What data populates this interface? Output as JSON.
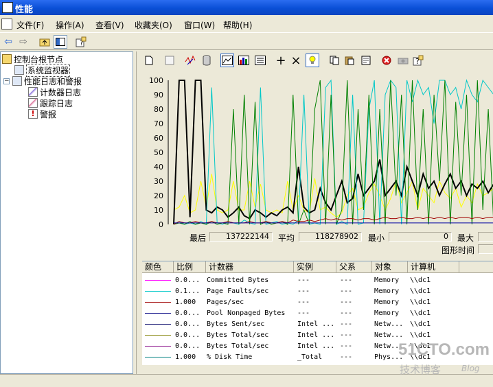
{
  "window": {
    "title": "性能"
  },
  "menu": [
    "文件(F)",
    "操作(A)",
    "查看(V)",
    "收藏夹(O)",
    "窗口(W)",
    "帮助(H)"
  ],
  "tree": {
    "items": [
      {
        "label": "控制台根节点",
        "level": 0,
        "icon": "folder-icon"
      },
      {
        "label": "系统监视器",
        "level": 1,
        "icon": "monitor-icon",
        "selected": true
      },
      {
        "label": "性能日志和警报",
        "level": 1,
        "icon": "logs-icon",
        "expanded": true
      },
      {
        "label": "计数器日志",
        "level": 2,
        "icon": "counter-log-icon"
      },
      {
        "label": "跟踪日志",
        "level": 2,
        "icon": "trace-log-icon"
      },
      {
        "label": "警报",
        "level": 2,
        "icon": "alert-icon"
      }
    ]
  },
  "stats": {
    "last_label": "最后",
    "last_value": "137222144",
    "avg_label": "平均",
    "avg_value": "118278902",
    "min_label": "最小",
    "min_value": "0",
    "max_label": "最大",
    "duration_label": "图形时间"
  },
  "legend": {
    "headers": [
      "颜色",
      "比例",
      "计数器",
      "实例",
      "父系",
      "对象",
      "计算机"
    ],
    "rows": [
      {
        "color": "#ff00ff",
        "scale": "0.0...",
        "counter": "Committed Bytes",
        "instance": "---",
        "parent": "---",
        "object": "Memory",
        "computer": "\\\\dc1"
      },
      {
        "color": "#00c8c8",
        "scale": "0.1...",
        "counter": "Page Faults/sec",
        "instance": "---",
        "parent": "---",
        "object": "Memory",
        "computer": "\\\\dc1"
      },
      {
        "color": "#a00000",
        "scale": "1.000",
        "counter": "Pages/sec",
        "instance": "---",
        "parent": "---",
        "object": "Memory",
        "computer": "\\\\dc1"
      },
      {
        "color": "#000080",
        "scale": "0.0...",
        "counter": "Pool Nonpaged Bytes",
        "instance": "---",
        "parent": "---",
        "object": "Memory",
        "computer": "\\\\dc1"
      },
      {
        "color": "#000064",
        "scale": "0.0...",
        "counter": "Bytes Sent/sec",
        "instance": "Intel ...",
        "parent": "---",
        "object": "Netw...",
        "computer": "\\\\dc1"
      },
      {
        "color": "#808000",
        "scale": "0.0...",
        "counter": "Bytes Total/sec",
        "instance": "Intel ...",
        "parent": "---",
        "object": "Netw...",
        "computer": "\\\\dc1"
      },
      {
        "color": "#800080",
        "scale": "0.0...",
        "counter": "Bytes Total/sec",
        "instance": "Intel ...",
        "parent": "---",
        "object": "Netw...",
        "computer": "\\\\dc1"
      },
      {
        "color": "#008080",
        "scale": "1.000",
        "counter": "% Disk Time",
        "instance": "_Total",
        "parent": "---",
        "object": "Phys...",
        "computer": "\\\\dc1"
      }
    ]
  },
  "watermark": {
    "line1": "51CTO.com",
    "line2": "技术博客",
    "line3": "Blog"
  },
  "chart_data": {
    "type": "line",
    "ylim": [
      0,
      100
    ],
    "yticks": [
      "100",
      "90",
      "80",
      "70",
      "60",
      "50",
      "40",
      "30",
      "20",
      "10",
      "0"
    ],
    "grid": false,
    "series": [
      {
        "color": "#ffff00",
        "values": [
          10,
          12,
          20,
          8,
          10,
          30,
          12,
          35,
          10,
          8,
          10,
          30,
          10,
          10,
          30,
          12,
          28,
          10,
          8,
          10,
          8,
          30,
          10,
          20,
          10,
          8,
          32,
          10,
          12,
          8,
          5,
          8,
          20,
          25,
          10,
          12,
          22,
          28,
          20,
          10,
          18,
          30,
          15,
          22,
          30,
          10,
          25,
          20,
          15,
          30,
          22,
          18,
          25,
          12,
          20,
          15,
          28,
          20,
          22,
          25
        ]
      },
      {
        "color": "#000000",
        "values": [
          0,
          100,
          100,
          5,
          100,
          100,
          10,
          8,
          12,
          10,
          5,
          8,
          12,
          6,
          4,
          10,
          8,
          5,
          8,
          6,
          10,
          12,
          8,
          40,
          12,
          8,
          10,
          25,
          15,
          10,
          20,
          30,
          15,
          18,
          35,
          20,
          25,
          30,
          45,
          20,
          25,
          30,
          20,
          40,
          30,
          20,
          35,
          25,
          30,
          20,
          28,
          35,
          25,
          30,
          20,
          28,
          25,
          30,
          22,
          28
        ]
      },
      {
        "color": "#00c8c8",
        "values": [
          0,
          2,
          0,
          1,
          0,
          2,
          0,
          95,
          1,
          0,
          2,
          1,
          0,
          3,
          1,
          0,
          95,
          0,
          1,
          2,
          0,
          1,
          0,
          3,
          90,
          0,
          1,
          0,
          95,
          100,
          0,
          2,
          0,
          90,
          0,
          1,
          80,
          100,
          0,
          90,
          100,
          95,
          0,
          100,
          85,
          100,
          90,
          95,
          70,
          100,
          100,
          90,
          95,
          80,
          100,
          90,
          85,
          100,
          95,
          90
        ]
      },
      {
        "color": "#008000",
        "values": [
          0,
          1,
          0,
          2,
          0,
          1,
          0,
          2,
          0,
          1,
          0,
          80,
          0,
          90,
          0,
          85,
          0,
          2,
          0,
          1,
          2,
          0,
          90,
          0,
          10,
          0,
          80,
          100,
          0,
          90,
          0,
          10,
          100,
          0,
          80,
          10,
          90,
          0,
          80,
          0,
          100,
          20,
          90,
          0,
          100,
          10,
          80,
          0,
          90,
          30,
          100,
          0,
          85,
          20,
          90,
          0,
          100,
          10,
          80,
          0
        ]
      },
      {
        "color": "#a00000",
        "values": [
          0,
          2,
          1,
          1,
          2,
          1,
          1,
          2,
          1,
          1,
          2,
          1,
          1,
          1,
          2,
          1,
          1,
          2,
          1,
          1,
          2,
          1,
          3,
          2,
          2,
          3,
          2,
          3,
          4,
          3,
          4,
          3,
          4,
          4,
          3,
          4,
          4,
          3,
          4,
          5,
          4,
          4,
          5,
          4,
          4,
          5,
          4,
          5,
          4,
          5,
          4,
          5,
          4,
          5,
          5,
          4,
          5,
          4,
          5,
          5
        ]
      },
      {
        "color": "#0000a0",
        "values": [
          1,
          1,
          1,
          1,
          1,
          1,
          1,
          1,
          1,
          1,
          1,
          1,
          1,
          1,
          1,
          1,
          1,
          1,
          1,
          1,
          1,
          1,
          1,
          1,
          1,
          1,
          1,
          1,
          1,
          1,
          1,
          1,
          1,
          1,
          1,
          1,
          1,
          1,
          1,
          1,
          1,
          1,
          1,
          1,
          1,
          1,
          1,
          1,
          1,
          1,
          1,
          1,
          1,
          1,
          1,
          1,
          1,
          1,
          1,
          1
        ]
      }
    ]
  }
}
